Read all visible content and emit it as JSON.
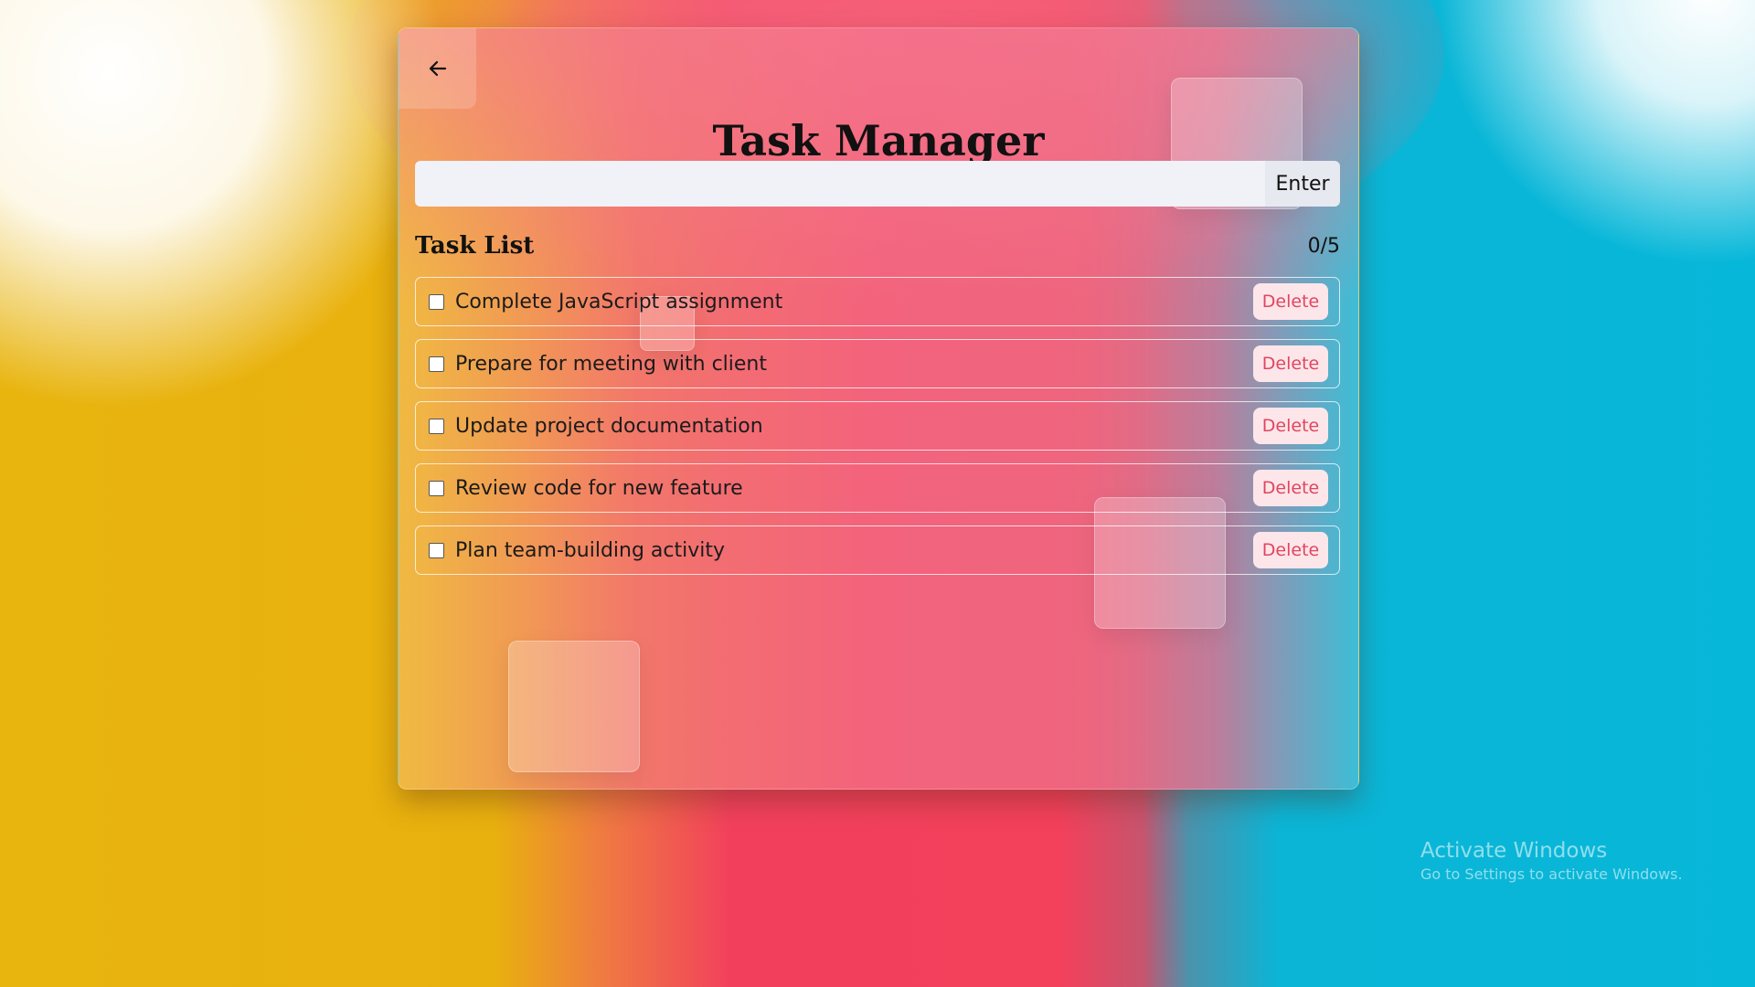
{
  "app": {
    "title": "Task Manager",
    "back_icon": "arrow-left-icon"
  },
  "input": {
    "value": "",
    "placeholder": "",
    "enter_label": "Enter"
  },
  "list": {
    "title": "Task List",
    "count": "0/5",
    "tasks": [
      {
        "text": "Complete JavaScript assignment",
        "done": false,
        "delete_label": "Delete"
      },
      {
        "text": "Prepare for meeting with client",
        "done": false,
        "delete_label": "Delete"
      },
      {
        "text": "Update project documentation",
        "done": false,
        "delete_label": "Delete"
      },
      {
        "text": "Review code for new feature",
        "done": false,
        "delete_label": "Delete"
      },
      {
        "text": "Plan team-building activity",
        "done": false,
        "delete_label": "Delete"
      }
    ]
  },
  "watermark": {
    "title": "Activate Windows",
    "subtitle": "Go to Settings to activate Windows."
  },
  "colors": {
    "accent_delete_text": "#e2455f",
    "delete_bg": "#fde6ea",
    "input_bg": "#f0f2f8"
  }
}
